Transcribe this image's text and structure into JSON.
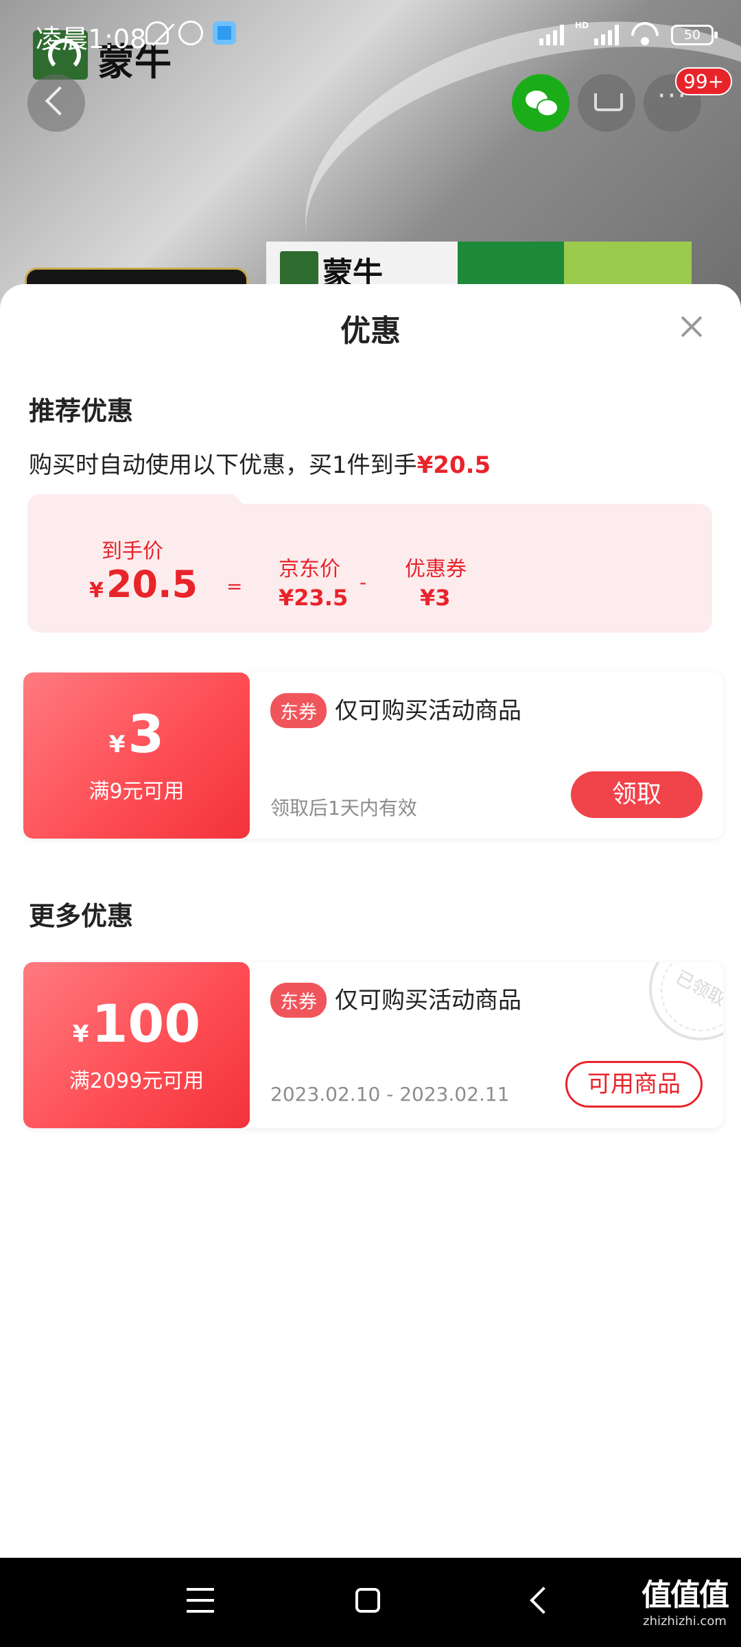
{
  "status_bar": {
    "time": "凌晨1:08",
    "hd": "HD",
    "battery": "50"
  },
  "background": {
    "brand_name": "蒙牛",
    "box_brand": "蒙牛"
  },
  "top_actions": {
    "more_badge": "99+",
    "more_glyph": "···"
  },
  "sheet": {
    "title": "优惠",
    "recommended": {
      "title": "推荐优惠",
      "desc_prefix": "购买时自动使用以下优惠，买1件到手",
      "desc_price": "¥20.5",
      "breakdown": {
        "final_label": "到手价",
        "final_currency": "¥",
        "final_value": "20.5",
        "equals": "=",
        "jd_label": "京东价",
        "jd_value": "¥23.5",
        "minus": "-",
        "coupon_label": "优惠券",
        "coupon_value": "¥3"
      },
      "coupon": {
        "currency": "¥",
        "amount": "3",
        "condition": "满9元可用",
        "tag": "东券",
        "scope": "仅可购买活动商品",
        "validity": "领取后1天内有效",
        "button": "领取"
      }
    },
    "more": {
      "title": "更多优惠",
      "coupon": {
        "currency": "¥",
        "amount": "100",
        "condition": "满2099元可用",
        "tag": "东券",
        "scope": "仅可购买活动商品",
        "validity": "2023.02.10 - 2023.02.11",
        "button": "可用商品",
        "stamp": "已领取"
      }
    }
  },
  "watermark": {
    "text": "值值值",
    "site": "zhizhizhi.com"
  },
  "colors": {
    "accent_red": "#e8242b",
    "coupon_gradient_start": "#ff7a80",
    "coupon_gradient_end": "#f2333a",
    "breakdown_bg": "#fdeced"
  }
}
